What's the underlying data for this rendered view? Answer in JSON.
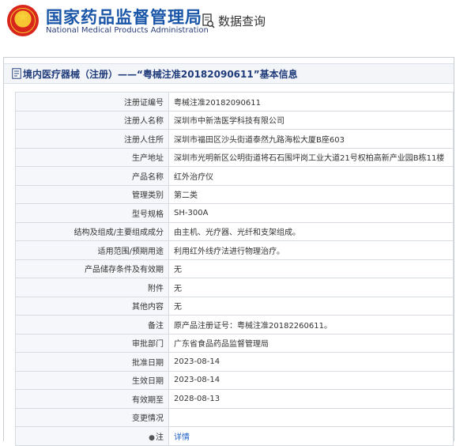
{
  "header": {
    "title_cn": "国家药品监督管理局",
    "title_en": "National Medical Products Administration",
    "query_label": "数据查询",
    "emblem_icon": "national-emblem-icon",
    "query_icon": "document-search-icon"
  },
  "section": {
    "title": "境内医疗器械（注册）——“粤械注准20182090611”基本信息",
    "icon": "document-icon"
  },
  "record": {
    "rows": [
      {
        "label": "注册证编号",
        "value": "粤械注准20182090611"
      },
      {
        "label": "注册人名称",
        "value": "深圳市中新浩医学科技有限公司"
      },
      {
        "label": "注册人住所",
        "value": "深圳市福田区沙头街道泰然九路海松大厦B座603"
      },
      {
        "label": "生产地址",
        "value": "深圳市光明新区公明街道将石石围坪岗工业大道21号权柏高新产业园B栋11楼"
      },
      {
        "label": "产品名称",
        "value": "红外治疗仪"
      },
      {
        "label": "管理类别",
        "value": "第二类"
      },
      {
        "label": "型号规格",
        "value": "SH-300A"
      },
      {
        "label": "结构及组成/主要组成成分",
        "value": "由主机、光疗器、光纤和支架组成。"
      },
      {
        "label": "适用范围/预期用途",
        "value": "利用红外线疗法进行物理治疗。"
      },
      {
        "label": "产品储存条件及有效期",
        "value": "无"
      },
      {
        "label": "附件",
        "value": "无"
      },
      {
        "label": "其他内容",
        "value": "无"
      },
      {
        "label": "备注",
        "value": "原产品注册证号：粤械注准20182260611。"
      },
      {
        "label": "审批部门",
        "value": "广东省食品药品监督管理局"
      },
      {
        "label": "批准日期",
        "value": "2023-08-14"
      },
      {
        "label": "生效日期",
        "value": "2023-08-14"
      },
      {
        "label": "有效期至",
        "value": "2028-08-13"
      },
      {
        "label": "变更情况",
        "value": ""
      }
    ],
    "note": {
      "label": "注",
      "pin_icon": "pin-icon",
      "link_text": "详情"
    }
  }
}
